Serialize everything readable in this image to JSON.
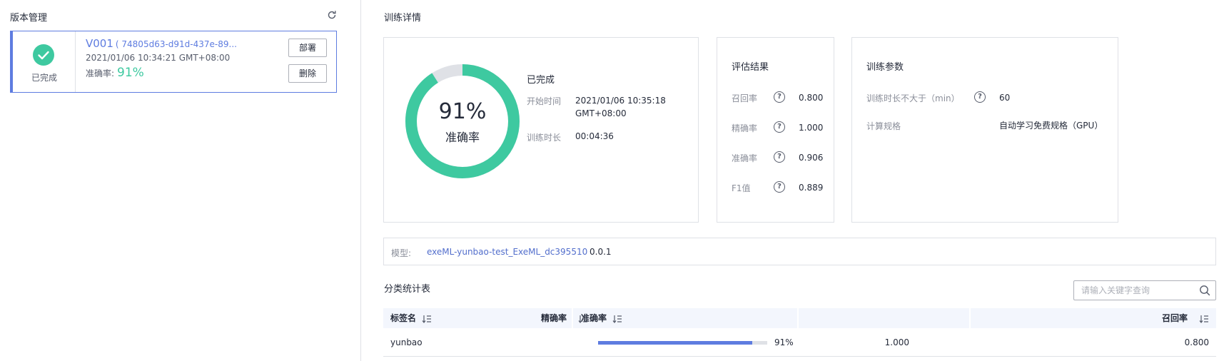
{
  "left": {
    "title": "版本管理",
    "version": {
      "status": "已完成",
      "name": "V001",
      "id": "( 74805d63-d91d-437e-89...",
      "time": "2021/01/06 10:34:21 GMT+08:00",
      "accuracy_label": "准确率:",
      "accuracy_value": "91%",
      "deploy_label": "部署",
      "delete_label": "删除"
    },
    "colors": {
      "accent": "#5e7ce0",
      "success": "#3ec9a0"
    },
    "icons": {
      "refresh": "refresh-icon",
      "status": "check-circle-icon"
    }
  },
  "detail": {
    "title": "训练详情",
    "progress": {
      "percent_text": "91%",
      "percent_value": 0.91,
      "label": "准确率",
      "status": "已完成",
      "start_label": "开始时间",
      "start_value_line1": "2021/01/06 10:35:18",
      "start_value_line2": "GMT+08:00",
      "duration_label": "训练时长",
      "duration_value": "00:04:36"
    },
    "eval": {
      "title": "评估结果",
      "items": [
        {
          "label": "召回率",
          "value": "0.800"
        },
        {
          "label": "精确率",
          "value": "1.000"
        },
        {
          "label": "准确率",
          "value": "0.906"
        },
        {
          "label": "F1值",
          "value": "0.889"
        }
      ]
    },
    "params": {
      "title": "训练参数",
      "items": [
        {
          "label": "训练时长不大于（min）",
          "value": "60",
          "has_help": true
        },
        {
          "label": "计算规格",
          "value": "自动学习免费规格（GPU）",
          "has_help": false
        }
      ]
    },
    "model": {
      "label": "模型:",
      "name": "exeML-yunbao-test_ExeML_dc395510",
      "version": "0.0.1"
    },
    "table": {
      "title": "分类统计表",
      "search_placeholder": "请输入关键字查询",
      "columns": [
        "标签名",
        "准确率",
        "精确率",
        "召回率"
      ],
      "rows": [
        {
          "label": "yunbao",
          "accuracy_text": "91%",
          "accuracy_value": 0.91,
          "precision": "1.000",
          "recall": "0.800"
        }
      ]
    }
  }
}
